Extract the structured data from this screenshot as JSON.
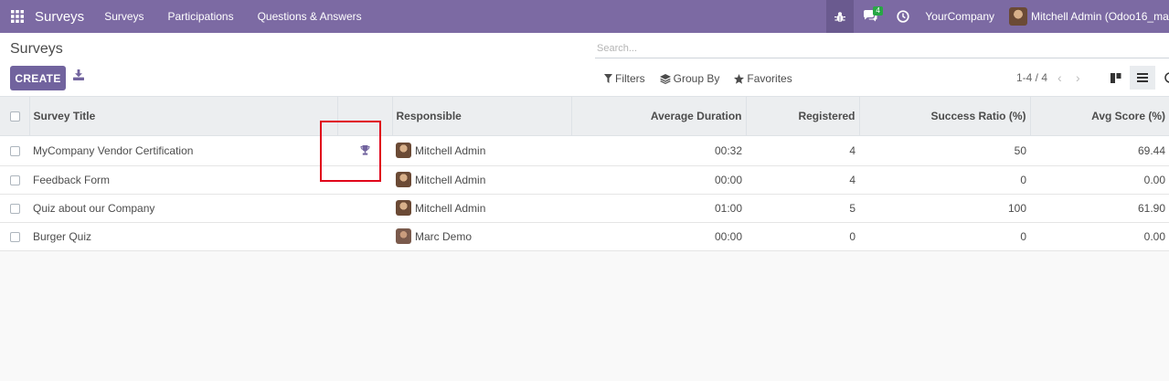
{
  "navbar": {
    "brand": "Surveys",
    "menu": [
      "Surveys",
      "Participations",
      "Questions & Answers"
    ],
    "message_count": "4",
    "company": "YourCompany",
    "user": "Mitchell Admin (Odoo16_ma"
  },
  "control_panel": {
    "title": "Surveys",
    "create_label": "CREATE",
    "search_placeholder": "Search...",
    "filters_label": "Filters",
    "groupby_label": "Group By",
    "favorites_label": "Favorites",
    "pager": "1-4 / 4"
  },
  "table": {
    "headers": [
      "Survey Title",
      "Responsible",
      "Average Duration",
      "Registered",
      "Success Ratio (%)",
      "Avg Score (%)"
    ],
    "rows": [
      {
        "title": "MyCompany Vendor Certification",
        "certification": true,
        "responsible": "Mitchell Admin",
        "duration": "00:32",
        "registered": "4",
        "success": "50",
        "score": "69.44"
      },
      {
        "title": "Feedback Form",
        "certification": false,
        "responsible": "Mitchell Admin",
        "duration": "00:00",
        "registered": "4",
        "success": "0",
        "score": "0.00"
      },
      {
        "title": "Quiz about our Company",
        "certification": false,
        "responsible": "Mitchell Admin",
        "duration": "01:00",
        "registered": "5",
        "success": "100",
        "score": "61.90"
      },
      {
        "title": "Burger Quiz",
        "certification": false,
        "responsible": "Marc Demo",
        "duration": "00:00",
        "registered": "0",
        "success": "0",
        "score": "0.00"
      }
    ]
  },
  "colors": {
    "navbar": "#7c6aa3",
    "primary_button": "#71639e",
    "highlight_box": "#e0001a",
    "badge": "#28a745"
  },
  "icons": [
    "apps-grid-icon",
    "bug-icon",
    "chat-icon",
    "clock-icon",
    "download-icon",
    "filter-icon",
    "layers-icon",
    "star-icon",
    "kanban-icon",
    "list-icon",
    "trophy-icon"
  ]
}
